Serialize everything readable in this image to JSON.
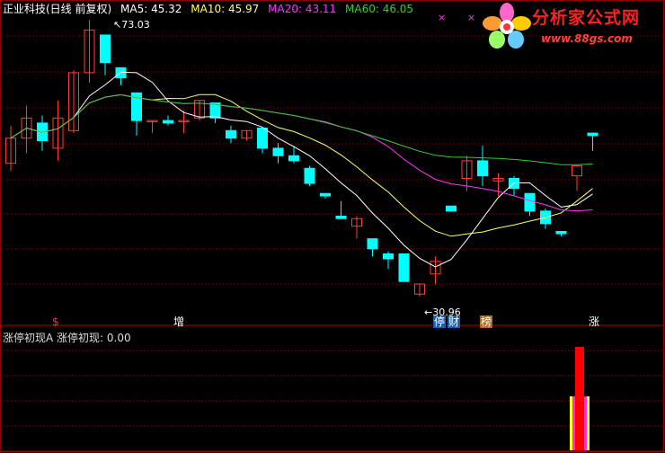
{
  "header": {
    "title": "正业科技(日线 前复权)",
    "ma5": "MA5: 45.32",
    "ma10": "MA10: 45.97",
    "ma20": "MA20: 43.11",
    "ma60": "MA60: 46.05",
    "marks": "× ×"
  },
  "logo": {
    "text": "分析家公式网",
    "url": "www.88gs.com"
  },
  "annotations": {
    "high": "73.03",
    "low": "30.96"
  },
  "event_tags": [
    {
      "label": "$",
      "color": "#ff3030",
      "bg": "transparent"
    },
    {
      "label": "增",
      "color": "#ffffff",
      "bg": "transparent"
    },
    {
      "label": "停",
      "color": "#ffffff",
      "bg": "#1a5fb4"
    },
    {
      "label": "财",
      "color": "#ffffff",
      "bg": "#1a5fb4"
    },
    {
      "label": "榜",
      "color": "#ffffff",
      "bg": "#b06a1e"
    },
    {
      "label": "涨",
      "color": "#ffffff",
      "bg": "transparent"
    }
  ],
  "indicator": {
    "title": "涨停初现A",
    "line": "涨停初现: 0.00"
  },
  "colors": {
    "up": "#ff3c3c",
    "down": "#00ffff",
    "ma5": "#ffffff",
    "ma10": "#ffff66",
    "ma20": "#ff33ff",
    "ma60": "#33cc33",
    "grid": "#8b0000"
  },
  "chart_data": {
    "type": "candlestick",
    "ohlc_up_down": "o,h,l,c",
    "high_mark": 73.03,
    "low_mark": 30.96,
    "candles": [
      [
        44.5,
        52.0,
        43.0,
        49.5
      ],
      [
        49.5,
        56.0,
        46.5,
        53.5
      ],
      [
        52.5,
        54.0,
        47.0,
        49.0
      ],
      [
        47.5,
        57.0,
        45.0,
        53.5
      ],
      [
        51.0,
        63.0,
        50.5,
        62.5
      ],
      [
        62.5,
        73.03,
        60.5,
        71.0
      ],
      [
        70.0,
        69.5,
        62.0,
        64.5
      ],
      [
        63.5,
        63.5,
        60.0,
        61.5
      ],
      [
        58.5,
        58.5,
        50.0,
        53.0
      ],
      [
        53.0,
        53.0,
        50.5,
        53.0
      ],
      [
        53.0,
        54.0,
        52.0,
        52.5
      ],
      [
        53.0,
        55.0,
        50.5,
        53.0
      ],
      [
        53.5,
        57.0,
        53.0,
        57.0
      ],
      [
        56.5,
        56.5,
        52.5,
        53.5
      ],
      [
        51.0,
        52.0,
        48.5,
        49.5
      ],
      [
        49.5,
        51.0,
        49.0,
        51.0
      ],
      [
        51.5,
        51.5,
        46.5,
        47.5
      ],
      [
        47.5,
        48.5,
        44.5,
        46.0
      ],
      [
        46.0,
        48.0,
        44.5,
        45.0
      ],
      [
        43.5,
        44.0,
        40.0,
        40.5
      ],
      [
        38.5,
        38.5,
        37.5,
        38.0
      ],
      [
        34.0,
        37.0,
        33.5,
        33.5
      ],
      [
        32.0,
        34.0,
        29.5,
        33.5
      ],
      [
        29.5,
        29.5,
        26.0,
        27.5
      ],
      [
        26.5,
        27.0,
        23.5,
        25.5
      ],
      [
        26.5,
        26.5,
        21.0,
        21.0
      ],
      [
        18.5,
        20.5,
        18.0,
        20.5
      ],
      [
        22.5,
        26.0,
        20.5,
        25.0
      ],
      [
        36.0,
        36.0,
        35.0,
        35.0
      ],
      [
        41.5,
        46.0,
        39.0,
        45.0
      ],
      [
        45.0,
        48.0,
        40.0,
        42.0
      ],
      [
        41.0,
        42.5,
        38.0,
        41.5
      ],
      [
        41.5,
        42.0,
        38.0,
        39.5
      ],
      [
        38.5,
        38.5,
        34.0,
        35.0
      ],
      [
        35.0,
        35.5,
        31.5,
        32.5
      ],
      [
        30.96,
        30.96,
        30.0,
        30.5
      ],
      [
        42.0,
        42.0,
        39.0,
        44.0
      ],
      [
        50.5,
        50.5,
        47.0,
        50.0
      ]
    ]
  }
}
